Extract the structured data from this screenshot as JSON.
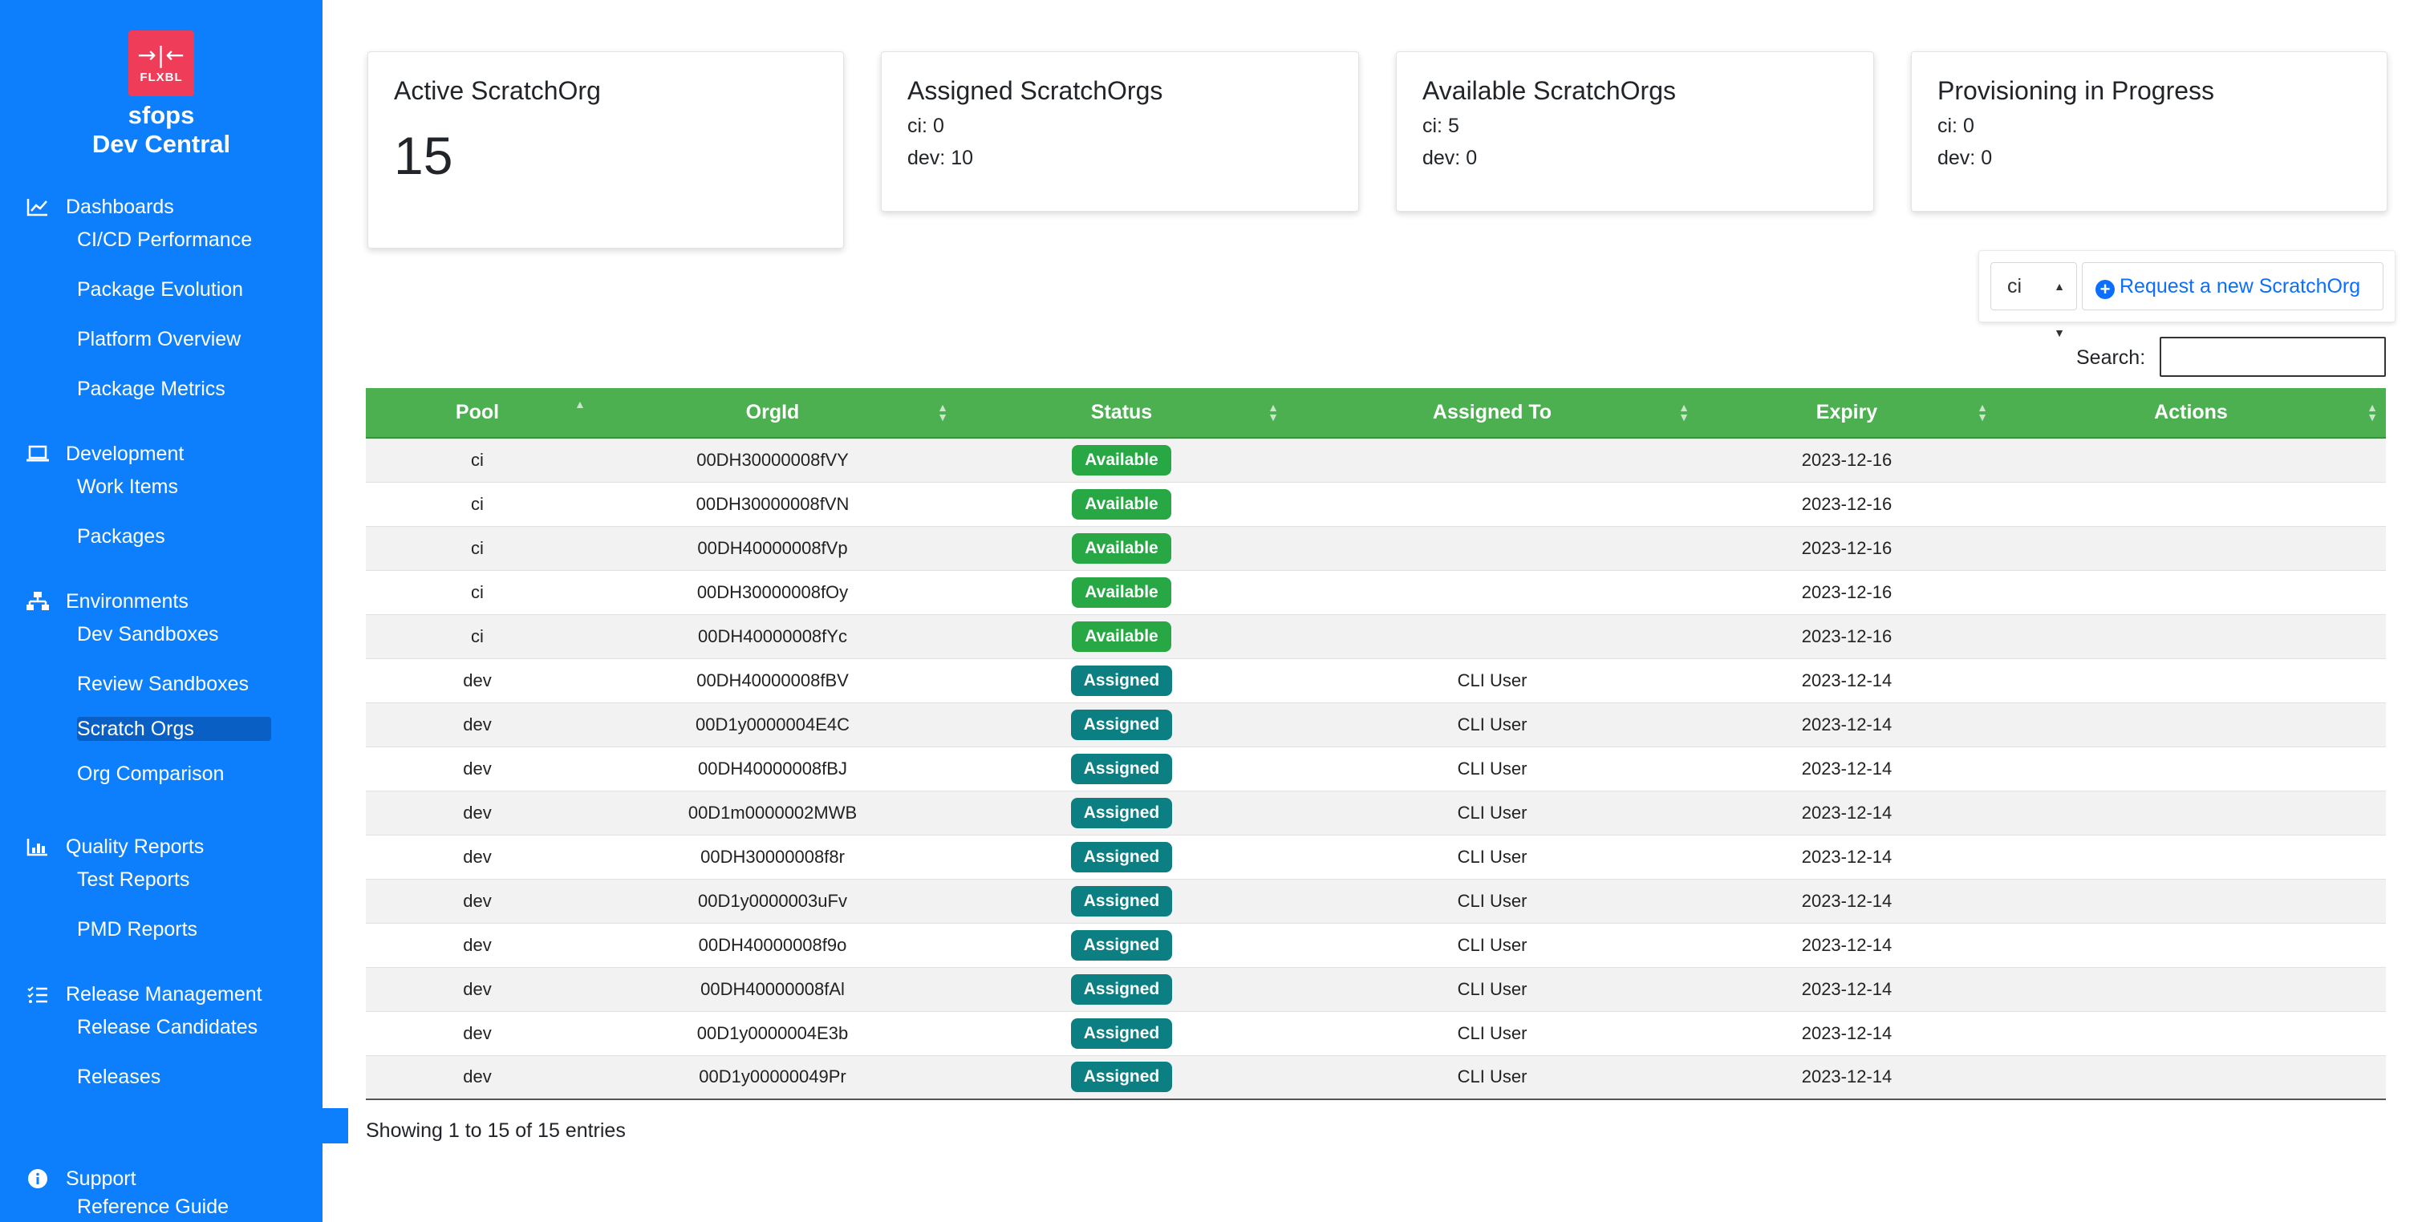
{
  "brand": {
    "logo_text": "FLXBL",
    "line1": "sfops",
    "line2": "Dev Central"
  },
  "sidebar": {
    "sections": [
      {
        "title": "Dashboards",
        "icon": "line-chart-icon",
        "items": [
          "CI/CD Performance",
          "Package Evolution",
          "Platform Overview",
          "Package Metrics"
        ]
      },
      {
        "title": "Development",
        "icon": "laptop-icon",
        "items": [
          "Work Items",
          "Packages"
        ]
      },
      {
        "title": "Environments",
        "icon": "sitemap-icon",
        "items": [
          "Dev Sandboxes",
          "Review Sandboxes",
          "Scratch Orgs",
          "Org Comparison"
        ]
      },
      {
        "title": "Quality Reports",
        "icon": "bar-chart-icon",
        "items": [
          "Test Reports",
          "PMD Reports"
        ]
      },
      {
        "title": "Release Management",
        "icon": "list-check-icon",
        "items": [
          "Release Candidates",
          "Releases"
        ]
      },
      {
        "title": "Support",
        "icon": "info-icon",
        "items": [
          "Reference Guide"
        ]
      }
    ],
    "active_item": "Scratch Orgs"
  },
  "cards": {
    "active": {
      "title": "Active ScratchOrg",
      "value": "15"
    },
    "assigned": {
      "title": "Assigned ScratchOrgs",
      "lines": [
        "ci: 0",
        "dev: 10"
      ]
    },
    "available": {
      "title": "Available ScratchOrgs",
      "lines": [
        "ci: 5",
        "dev: 0"
      ]
    },
    "provisioning": {
      "title": "Provisioning in Progress",
      "lines": [
        "ci: 0",
        "dev: 0"
      ]
    }
  },
  "request": {
    "pool_value": "ci",
    "button_label": "Request a new ScratchOrg"
  },
  "search": {
    "label": "Search:",
    "value": ""
  },
  "table": {
    "columns": [
      "Pool",
      "OrgId",
      "Status",
      "Assigned To",
      "Expiry",
      "Actions"
    ],
    "rows": [
      {
        "pool": "ci",
        "orgid": "00DH30000008fVY",
        "status": "Available",
        "assigned": "",
        "expiry": "2023-12-16"
      },
      {
        "pool": "ci",
        "orgid": "00DH30000008fVN",
        "status": "Available",
        "assigned": "",
        "expiry": "2023-12-16"
      },
      {
        "pool": "ci",
        "orgid": "00DH40000008fVp",
        "status": "Available",
        "assigned": "",
        "expiry": "2023-12-16"
      },
      {
        "pool": "ci",
        "orgid": "00DH30000008fOy",
        "status": "Available",
        "assigned": "",
        "expiry": "2023-12-16"
      },
      {
        "pool": "ci",
        "orgid": "00DH40000008fYc",
        "status": "Available",
        "assigned": "",
        "expiry": "2023-12-16"
      },
      {
        "pool": "dev",
        "orgid": "00DH40000008fBV",
        "status": "Assigned",
        "assigned": "CLI User",
        "expiry": "2023-12-14"
      },
      {
        "pool": "dev",
        "orgid": "00D1y0000004E4C",
        "status": "Assigned",
        "assigned": "CLI User",
        "expiry": "2023-12-14"
      },
      {
        "pool": "dev",
        "orgid": "00DH40000008fBJ",
        "status": "Assigned",
        "assigned": "CLI User",
        "expiry": "2023-12-14"
      },
      {
        "pool": "dev",
        "orgid": "00D1m0000002MWB",
        "status": "Assigned",
        "assigned": "CLI User",
        "expiry": "2023-12-14"
      },
      {
        "pool": "dev",
        "orgid": "00DH30000008f8r",
        "status": "Assigned",
        "assigned": "CLI User",
        "expiry": "2023-12-14"
      },
      {
        "pool": "dev",
        "orgid": "00D1y0000003uFv",
        "status": "Assigned",
        "assigned": "CLI User",
        "expiry": "2023-12-14"
      },
      {
        "pool": "dev",
        "orgid": "00DH40000008f9o",
        "status": "Assigned",
        "assigned": "CLI User",
        "expiry": "2023-12-14"
      },
      {
        "pool": "dev",
        "orgid": "00DH40000008fAl",
        "status": "Assigned",
        "assigned": "CLI User",
        "expiry": "2023-12-14"
      },
      {
        "pool": "dev",
        "orgid": "00D1y0000004E3b",
        "status": "Assigned",
        "assigned": "CLI User",
        "expiry": "2023-12-14"
      },
      {
        "pool": "dev",
        "orgid": "00D1y00000049Pr",
        "status": "Assigned",
        "assigned": "CLI User",
        "expiry": "2023-12-14"
      }
    ],
    "info": "Showing 1 to 15 of 15 entries"
  },
  "colors": {
    "sidebar": "#0d7ffd",
    "header": "#4caf50",
    "available": "#28a745",
    "assigned": "#0c7f82",
    "logo": "#ef3d59"
  }
}
